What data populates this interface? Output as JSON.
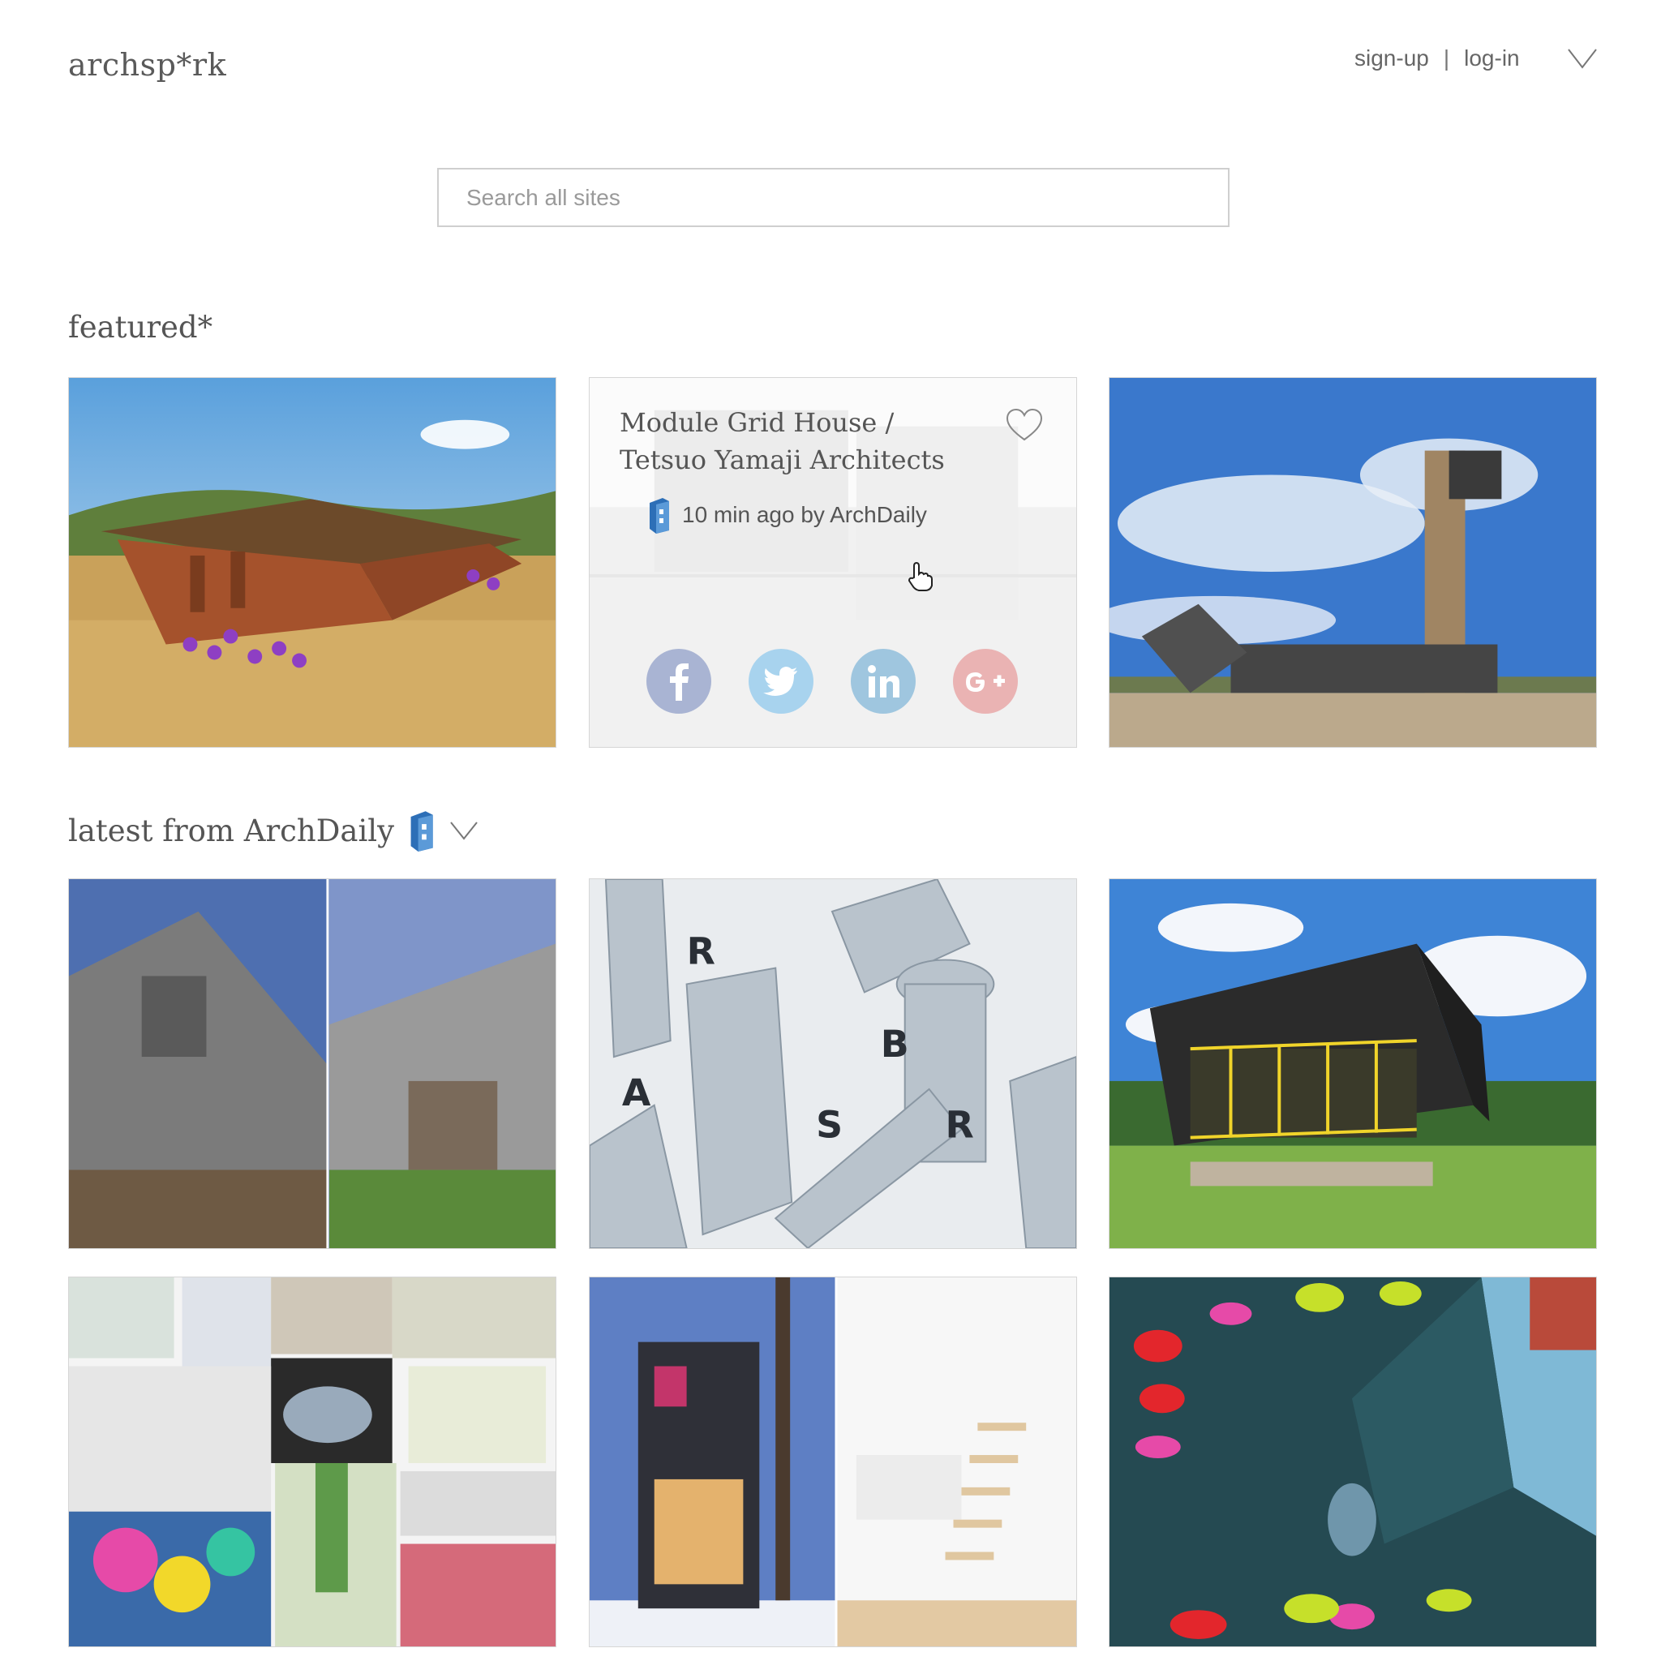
{
  "header": {
    "logo": "archsp*rk",
    "signup_label": "sign-up",
    "separator": "|",
    "login_label": "log-in"
  },
  "search": {
    "placeholder": "Search all sites"
  },
  "featured": {
    "title": "featured*",
    "card": {
      "title": "Module Grid House / Tetsuo Yamaji Architects",
      "meta": "10 min ago by ArchDaily",
      "share_icons": [
        "facebook-icon",
        "twitter-icon",
        "linkedin-icon",
        "google-plus-icon"
      ]
    }
  },
  "latest": {
    "title": "latest from ArchDaily"
  },
  "colors": {
    "facebook": "#a9b4d3",
    "twitter": "#a8d3ee",
    "linkedin": "#9fc6df",
    "google_plus": "#eab3b3",
    "text": "#555555",
    "border": "#cfcfcf"
  }
}
